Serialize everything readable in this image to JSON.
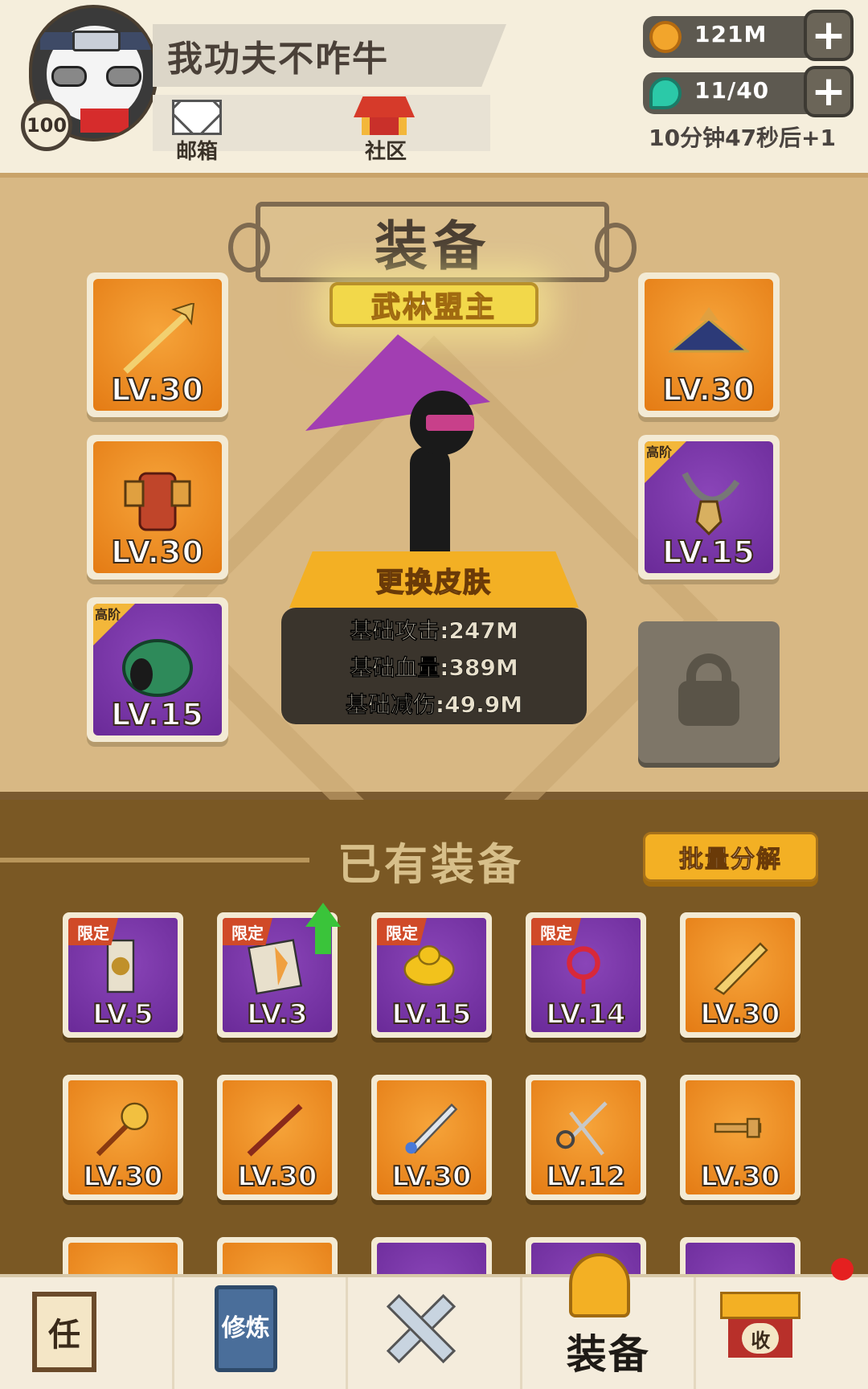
{
  "player": {
    "name": "我功夫不咋牛",
    "level": "100",
    "mail_label": "邮箱",
    "community_label": "社区"
  },
  "resources": {
    "coins": "121M",
    "energy": "11/40",
    "timer": "10分钟47秒后+1",
    "plus": "+"
  },
  "equipment": {
    "title": "装备",
    "rank_title": "武林盟主",
    "change_skin": "更换皮肤",
    "stats": [
      "基础攻击:247M",
      "基础血量:389M",
      "基础减伤:49.9M"
    ],
    "high_tier_tag": "高阶",
    "slots": [
      {
        "name": "spear",
        "level": "LV.30",
        "rarity": "orange"
      },
      {
        "name": "armor",
        "level": "LV.30",
        "rarity": "orange"
      },
      {
        "name": "bracer",
        "level": "LV.15",
        "rarity": "purple",
        "high": true
      },
      {
        "name": "hat",
        "level": "LV.30",
        "rarity": "orange"
      },
      {
        "name": "necklace",
        "level": "LV.15",
        "rarity": "purple",
        "high": true
      },
      {
        "name": "locked",
        "level": "",
        "rarity": "locked"
      }
    ]
  },
  "owned": {
    "title": "已有装备",
    "batch_button": "批量分解",
    "limited_tag": "限定",
    "items": [
      {
        "name": "banner",
        "level": "LV.5",
        "rarity": "purple",
        "limited": true
      },
      {
        "name": "book",
        "level": "LV.3",
        "rarity": "purple",
        "limited": true,
        "upgrade": true
      },
      {
        "name": "gold-ingot",
        "level": "LV.15",
        "rarity": "purple",
        "limited": true
      },
      {
        "name": "chinese-knot",
        "level": "LV.14",
        "rarity": "purple",
        "limited": true
      },
      {
        "name": "broadsword",
        "level": "LV.30",
        "rarity": "orange"
      },
      {
        "name": "mace",
        "level": "LV.30",
        "rarity": "orange"
      },
      {
        "name": "staff",
        "level": "LV.30",
        "rarity": "orange"
      },
      {
        "name": "sword",
        "level": "LV.30",
        "rarity": "orange"
      },
      {
        "name": "scissors",
        "level": "LV.12",
        "rarity": "orange"
      },
      {
        "name": "key",
        "level": "LV.30",
        "rarity": "orange"
      }
    ]
  },
  "nav": {
    "task": "任",
    "cultivate": "修炼",
    "equip": "装备",
    "shop": "收"
  },
  "colors": {
    "orange": "#e47b14",
    "purple": "#6a2a98",
    "gold": "#f3b024",
    "panel_dark": "#7a5824"
  }
}
